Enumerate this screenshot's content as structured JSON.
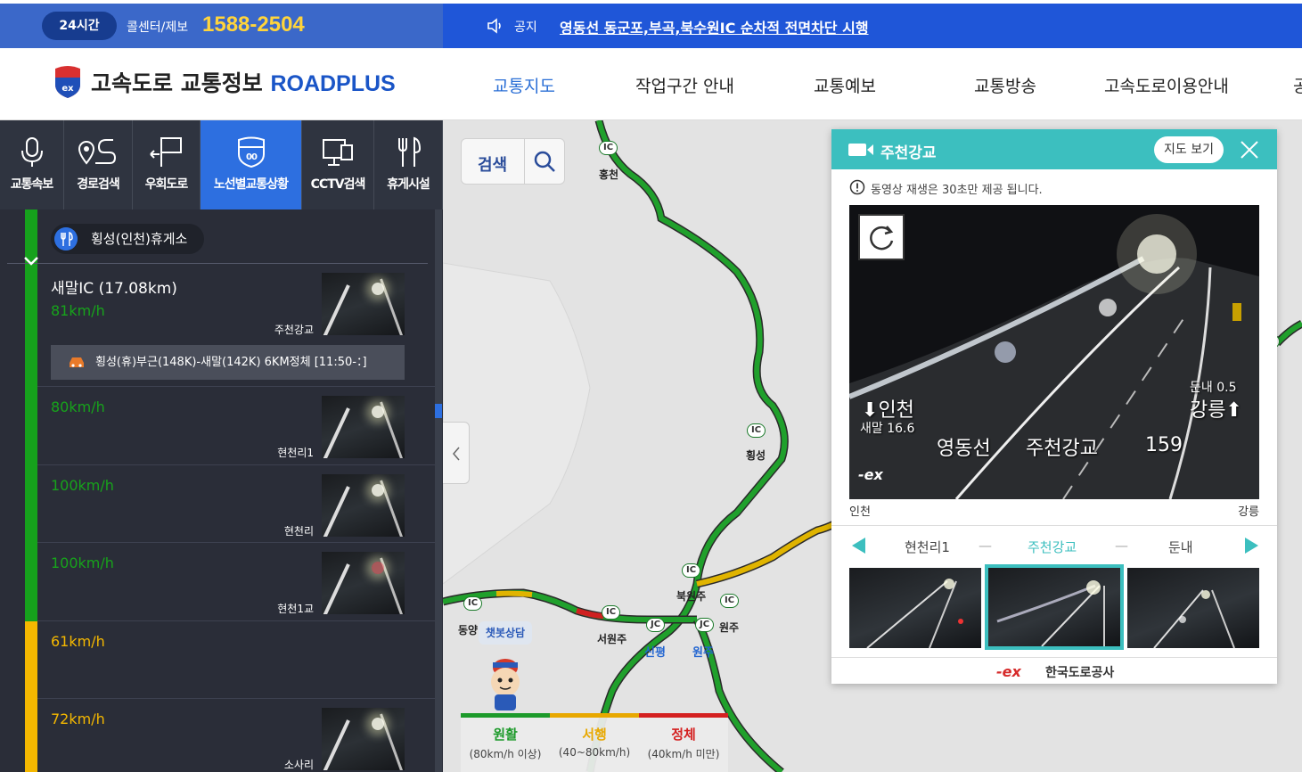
{
  "topbar": {
    "hours_badge": "24시간",
    "callcenter_label": "콜센터/제보",
    "phone": "1588-2504",
    "notice_label": "공지",
    "notice_text": "영동선 동군포,부곡,북수원IC 순차적 전면차단 시행"
  },
  "header": {
    "logo_text": "고속도로 교통정보",
    "logo_brand": "ROADPLUS",
    "nav": [
      "교통지도",
      "작업구간 안내",
      "교통예보",
      "교통방송",
      "고속도로이용안내",
      "공"
    ],
    "nav_active_index": 0,
    "accent_color": "#2b6fd6"
  },
  "left_panel": {
    "tabs": [
      {
        "label": "교통속보",
        "icon": "microphone-icon"
      },
      {
        "label": "경로검색",
        "icon": "route-icon"
      },
      {
        "label": "우회도로",
        "icon": "detour-sign-icon"
      },
      {
        "label": "노선별교통상황",
        "icon": "highway-shield-icon"
      },
      {
        "label": "CCTV검색",
        "icon": "monitor-icon"
      },
      {
        "label": "휴게시설",
        "icon": "fork-knife-icon"
      }
    ],
    "active_tab_index": 3,
    "rest_area": "횡성(인천)휴게소",
    "segments": [
      {
        "title": "새말IC (17.08km)",
        "speed": "81km/h",
        "camera": "주천강교",
        "level": "green"
      },
      {
        "speed": "80km/h",
        "camera": "현천리1",
        "level": "green"
      },
      {
        "speed": "100km/h",
        "camera": "현천리",
        "level": "green"
      },
      {
        "speed": "100km/h",
        "camera": "현천1교",
        "level": "green"
      },
      {
        "speed": "61km/h",
        "camera": "",
        "level": "yellow"
      },
      {
        "speed": "72km/h",
        "camera": "소사리",
        "level": "yellow"
      }
    ],
    "incident": "횡성(휴)부근(148K)-새말(142K) 6KM정체 [11:50-：]"
  },
  "map": {
    "search_label": "검색",
    "labels": [
      "홍천",
      "횡성",
      "북원주",
      "원주",
      "서원주",
      "동양",
      "신평",
      "원주"
    ],
    "ic_tags": [
      "IC",
      "IC",
      "IC",
      "IC",
      "IC",
      "IC",
      "JC",
      "JC",
      "IC"
    ],
    "chatbot_label": "챗봇상담",
    "legend": [
      {
        "title": "원활",
        "sub": "(80km/h 이상)",
        "color": "#1c9a2a"
      },
      {
        "title": "서행",
        "sub": "(40~80km/h)",
        "color": "#e8a800"
      },
      {
        "title": "정체",
        "sub": "(40km/h 미만)",
        "color": "#d42020"
      }
    ]
  },
  "cctv_popup": {
    "title": "주천강교",
    "map_view_button": "지도 보기",
    "note": "동영상 재생은 30초만 제공 됩니다.",
    "video_overlay": {
      "dir_left": "인천",
      "dir_left_sub": "새말 16.6",
      "dir_right": "강릉",
      "dir_right_sub": "둔내 0.5",
      "line": "영동선",
      "place": "주천강교",
      "km": "159"
    },
    "from": "인천",
    "to": "강릉",
    "nav_prev": "현천리1",
    "nav_current": "주천강교",
    "nav_next": "둔내",
    "nav_dash": "—",
    "footer": "한국도로공사",
    "accent_color": "#3cbfbf"
  }
}
